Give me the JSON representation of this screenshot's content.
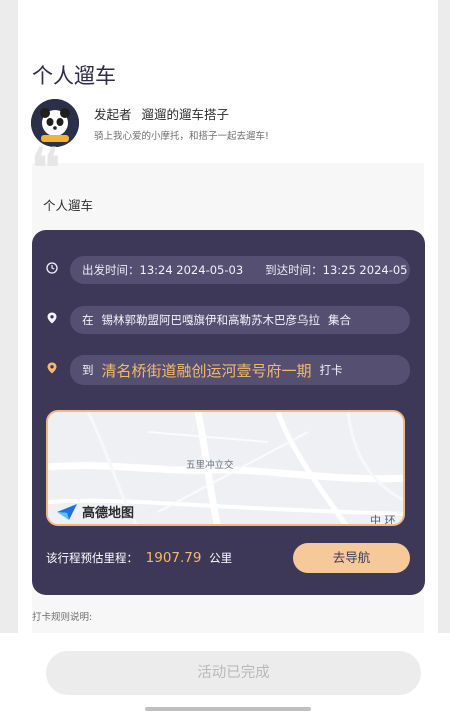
{
  "page": {
    "title": "个人遛车"
  },
  "initiator": {
    "label": "发起者",
    "name": "遛遛的遛车搭子",
    "bio": "骑上我心爱的小摩托，和搭子一起去遛车!"
  },
  "content": {
    "title": "个人遛车"
  },
  "trip": {
    "departure_label": "出发时间：",
    "departure_value": "13:24 2024-05-03",
    "arrival_label": "到达时间：",
    "arrival_value": "13:25 2024-05",
    "meet_prefix": "在",
    "meet_place": "锡林郭勒盟阿巴嘎旗伊和高勒苏木巴彦乌拉",
    "meet_suffix": "集合",
    "dest_prefix": "到",
    "dest_place": "清名桥街道融创运河壹号府一期",
    "dest_suffix": "打卡"
  },
  "map": {
    "place_label": "五里冲立交",
    "city_partial": "中 环",
    "provider": "高德地图"
  },
  "distance": {
    "label": "该行程预估里程：",
    "value": "1907.79",
    "unit": "公里"
  },
  "nav_button": "去导航",
  "rules_label": "打卡规则说明:",
  "status_button": "活动已完成",
  "colors": {
    "trip_bg": "#3e3858",
    "accent": "#f5b96b",
    "nav_button_bg": "#f6c99a",
    "pill_bg": "#555072"
  },
  "icons": {
    "time": "clock-icon",
    "meet": "location-pin-icon",
    "dest": "location-pin-icon-orange",
    "map_logo": "amap-logo-icon"
  }
}
